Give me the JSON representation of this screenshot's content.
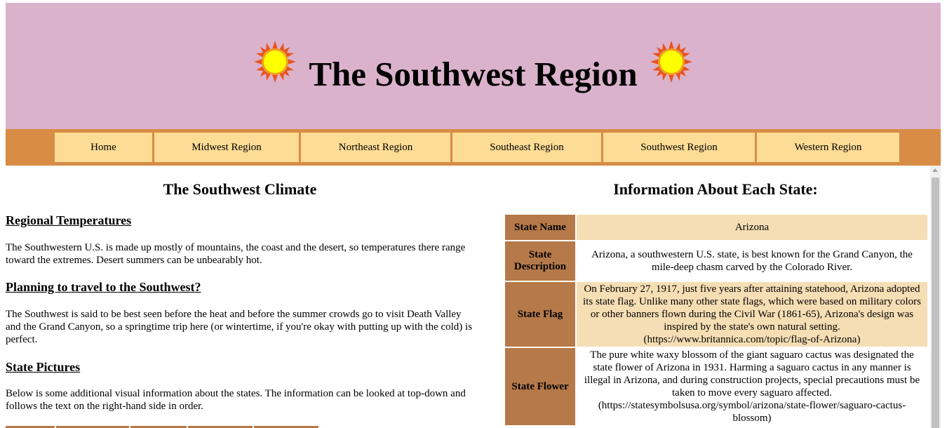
{
  "header": {
    "title": "The Southwest Region",
    "left_icon": "sun-icon",
    "right_icon": "sun-icon",
    "background": "#dbb2cc"
  },
  "nav": {
    "background": "#d88c45",
    "item_background": "#fddc95",
    "items": [
      {
        "label": "Home"
      },
      {
        "label": "Midwest Region"
      },
      {
        "label": "Northeast Region"
      },
      {
        "label": "Southeast Region"
      },
      {
        "label": "Southwest Region"
      },
      {
        "label": "Western Region"
      }
    ]
  },
  "left": {
    "heading": "The Southwest Climate",
    "sections": [
      {
        "title": "Regional Temperatures",
        "text": "The Southwestern U.S. is made up mostly of mountains, the coast and the desert, so temperatures there range toward the extremes. Desert summers can be unbearably hot."
      },
      {
        "title": "Planning to travel to the Southwest?",
        "text": "The Southwest is said to be best seen before the heat and before the summer crowds go to visit Death Valley and the Grand Canyon, so a springtime trip here (or wintertime, if you're okay with putting up with the cold) is perfect."
      },
      {
        "title": "State Pictures",
        "text": "Below is some additional visual information about the states. The information can be looked at top-down and follows the text on the right-hand side in order."
      }
    ]
  },
  "right": {
    "heading": "Information About Each State:",
    "header_cell_color": "#b5794a",
    "alt_row_color": "#f6deb4",
    "rows": [
      {
        "label": "State Name",
        "value": "Arizona"
      },
      {
        "label": "State Description",
        "value": "Arizona, a southwestern U.S. state, is best known for the Grand Canyon, the mile-deep chasm carved by the Colorado River."
      },
      {
        "label": "State Flag",
        "value": "On February 27, 1917, just five years after attaining statehood, Arizona adopted its state flag. Unlike many other state flags, which were based on military colors or other banners flown during the Civil War (1861-65), Arizona's design was inspired by the state's own natural setting. (https://www.britannica.com/topic/flag-of-Arizona)"
      },
      {
        "label": "State Flower",
        "value": "The pure white waxy blossom of the giant saguaro cactus was designated the state flower of Arizona in 1931. Harming a saguaro cactus in any manner is illegal in Arizona, and during construction projects, special precautions must be taken to move every saguaro affected. (https://statesymbolsusa.org/symbol/arizona/state-flower/saguaro-cactus-blossom)"
      }
    ]
  }
}
